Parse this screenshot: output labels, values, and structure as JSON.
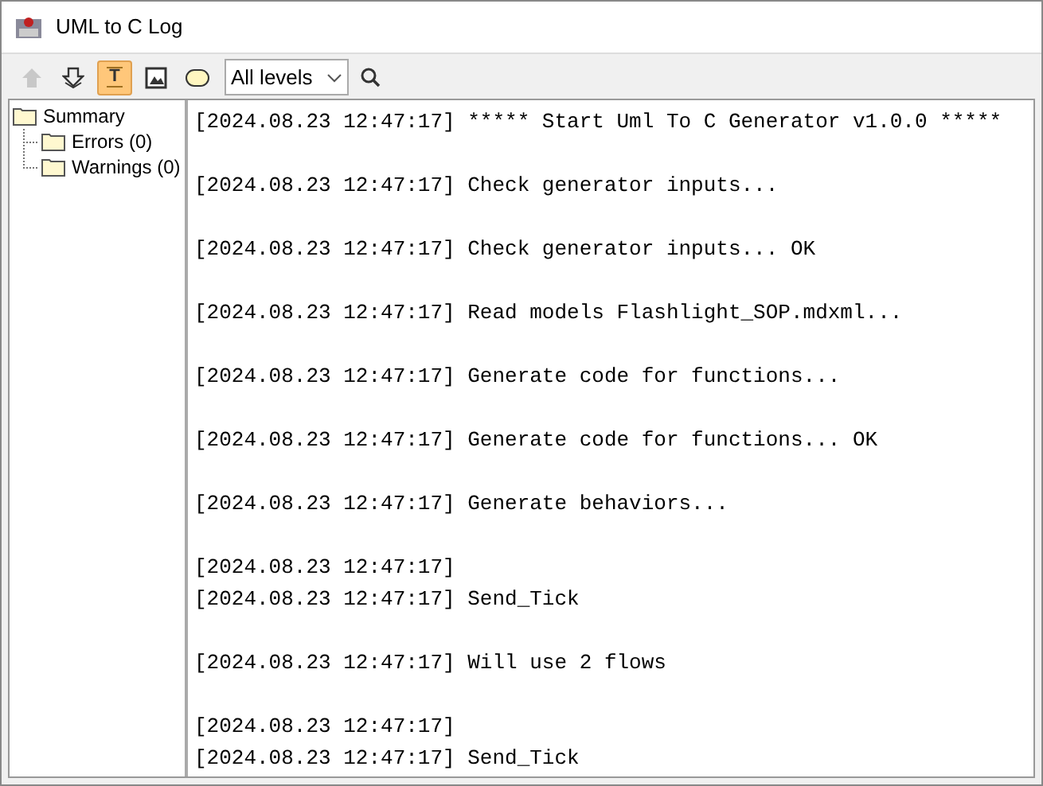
{
  "window": {
    "title": "UML to C Log"
  },
  "toolbar": {
    "buttons": [
      {
        "kind": "up",
        "disabled": true,
        "selected": false
      },
      {
        "kind": "down",
        "disabled": false,
        "selected": false
      },
      {
        "kind": "text",
        "label": "T",
        "disabled": false,
        "selected": true
      },
      {
        "kind": "image",
        "disabled": false,
        "selected": false
      },
      {
        "kind": "shape",
        "disabled": false,
        "selected": false
      }
    ],
    "level_filter": {
      "value": "All levels"
    }
  },
  "tree": {
    "items": [
      {
        "label": "Summary",
        "children": [
          {
            "label": "Errors (0)"
          },
          {
            "label": "Warnings (0)"
          }
        ]
      }
    ]
  },
  "log": {
    "entries": [
      {
        "lines": [
          "[2024.08.23 12:47:17] ***** Start Uml To C Generator v1.0.0 *****"
        ]
      },
      {
        "lines": [
          "[2024.08.23 12:47:17] Check generator inputs..."
        ]
      },
      {
        "lines": [
          "[2024.08.23 12:47:17] Check generator inputs... OK"
        ]
      },
      {
        "lines": [
          "[2024.08.23 12:47:17] Read models Flashlight_SOP.mdxml..."
        ]
      },
      {
        "lines": [
          "[2024.08.23 12:47:17] Generate code for functions..."
        ]
      },
      {
        "lines": [
          "[2024.08.23 12:47:17] Generate code for functions... OK"
        ]
      },
      {
        "lines": [
          "[2024.08.23 12:47:17] Generate behaviors..."
        ]
      },
      {
        "lines": [
          "[2024.08.23 12:47:17]",
          "[2024.08.23 12:47:17] Send_Tick"
        ]
      },
      {
        "lines": [
          "[2024.08.23 12:47:17] Will use 2 flows"
        ]
      },
      {
        "lines": [
          "[2024.08.23 12:47:17]",
          "[2024.08.23 12:47:17] Send_Tick"
        ]
      }
    ]
  }
}
